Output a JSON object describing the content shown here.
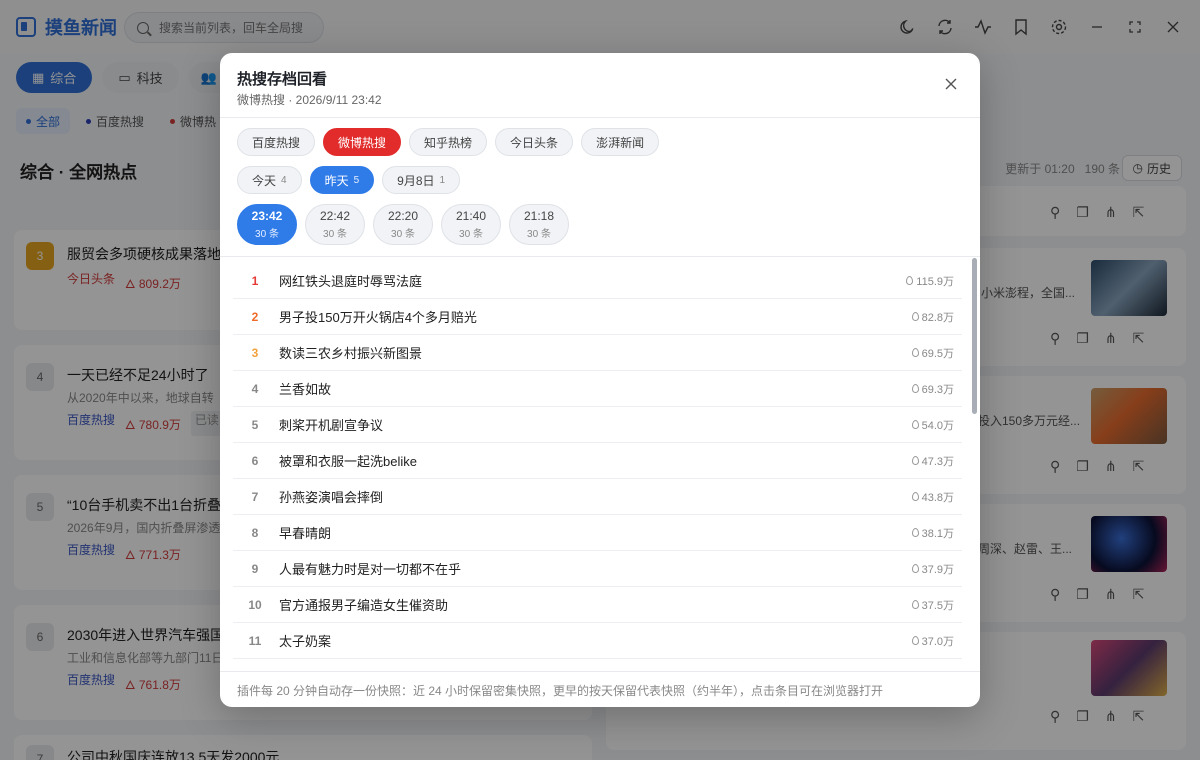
{
  "app": {
    "title": "摸鱼新闻",
    "search_placeholder": "搜索当前列表，回车全局搜"
  },
  "top_icons": [
    "moon-icon",
    "refresh-icon",
    "activity-icon",
    "bookmark-icon",
    "gear-icon",
    "minimize-icon",
    "maximize-icon",
    "close-icon"
  ],
  "categories": [
    {
      "label": "综合",
      "active": true
    },
    {
      "label": "科技",
      "active": false
    }
  ],
  "filters": [
    {
      "label": "全部",
      "active": true
    },
    {
      "label": "百度热搜",
      "active": false
    },
    {
      "label": "微博热"
    }
  ],
  "section": {
    "title": "综合 · 全网热点",
    "updated": "更新于 01:20",
    "count": "190 条",
    "history_label": "历史"
  },
  "background_news": [
    {
      "rank": "3",
      "title": "服贸会多项硬核成果落地",
      "desc": "",
      "source": "今日头条",
      "heat": "809.2万"
    },
    {
      "rank": "4",
      "title": "一天已经不足24小时了",
      "desc": "从2020年中以来，地球自转",
      "source": "百度热搜",
      "heat": "780.9万",
      "tag": "已读"
    },
    {
      "rank": "5",
      "title": "“10台手机卖不出1台折叠",
      "desc": "2026年9月，国内折叠屏渗透",
      "source": "百度热搜",
      "heat": "771.3万"
    },
    {
      "rank": "6",
      "title": "2030年进入世界汽车强国",
      "desc": "工业和信息化部等九部门11日",
      "source": "百度热搜",
      "heat": "761.8万"
    },
    {
      "rank": "7",
      "title": "公司中秋国庆连放13.5天发2000元",
      "desc": "",
      "source": "",
      "heat": ""
    }
  ],
  "right_snippets": [
    "小米澎程，全国...",
    "投入150多万元经...",
    "周深、赵雷、王..."
  ],
  "modal": {
    "title": "热搜存档回看",
    "subtitle": "微博热搜 · 2026/9/11 23:42",
    "source_tabs": [
      {
        "label": "百度热搜",
        "active": false
      },
      {
        "label": "微博热搜",
        "active": true
      },
      {
        "label": "知乎热榜",
        "active": false
      },
      {
        "label": "今日头条",
        "active": false
      },
      {
        "label": "澎湃新闻",
        "active": false
      }
    ],
    "day_tabs": [
      {
        "label": "今天",
        "count": "4",
        "active": false
      },
      {
        "label": "昨天",
        "count": "5",
        "active": true
      },
      {
        "label": "9月8日",
        "count": "1",
        "active": false
      }
    ],
    "time_tabs": [
      {
        "time": "23:42",
        "count": "30 条",
        "active": true
      },
      {
        "time": "22:42",
        "count": "30 条",
        "active": false
      },
      {
        "time": "22:20",
        "count": "30 条",
        "active": false
      },
      {
        "time": "21:40",
        "count": "30 条",
        "active": false
      },
      {
        "time": "21:18",
        "count": "30 条",
        "active": false
      }
    ],
    "items": [
      {
        "rank": "1",
        "title": "网红铁头退庭时辱骂法庭",
        "heat": "115.9万"
      },
      {
        "rank": "2",
        "title": "男子投150万开火锅店4个多月赔光",
        "heat": "82.8万"
      },
      {
        "rank": "3",
        "title": "数读三农乡村振兴新图景",
        "heat": "69.5万"
      },
      {
        "rank": "4",
        "title": "兰香如故",
        "heat": "69.3万"
      },
      {
        "rank": "5",
        "title": "刺桨开机剧宣争议",
        "heat": "54.0万"
      },
      {
        "rank": "6",
        "title": "被罩和衣服一起洗belike",
        "heat": "47.3万"
      },
      {
        "rank": "7",
        "title": "孙燕姿演唱会摔倒",
        "heat": "43.8万"
      },
      {
        "rank": "8",
        "title": "早春晴朗",
        "heat": "38.1万"
      },
      {
        "rank": "9",
        "title": "人最有魅力时是对一切都不在乎",
        "heat": "37.9万"
      },
      {
        "rank": "10",
        "title": "官方通报男子编造女生催资助",
        "heat": "37.5万"
      },
      {
        "rank": "11",
        "title": "太子奶案",
        "heat": "37.0万"
      }
    ],
    "footer": "插件每 20 分钟自动存一份快照：近 24 小时保留密集快照，更早的按天保留代表快照（约半年），点击条目可在浏览器打开"
  }
}
